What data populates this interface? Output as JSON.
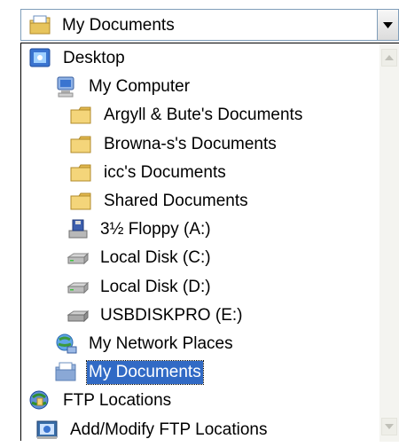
{
  "combo": {
    "selected_label": "My Documents",
    "selected_icon": "my-documents-icon"
  },
  "items": [
    {
      "label": "Desktop",
      "icon": "desktop-icon"
    },
    {
      "label": "My Computer",
      "icon": "my-computer-icon"
    },
    {
      "label": "Argyll & Bute's Documents",
      "icon": "folder-icon"
    },
    {
      "label": "Browna-s's Documents",
      "icon": "folder-icon"
    },
    {
      "label": "icc's Documents",
      "icon": "folder-icon"
    },
    {
      "label": "Shared Documents",
      "icon": "folder-icon"
    },
    {
      "label": "3½ Floppy (A:)",
      "icon": "floppy-drive-icon"
    },
    {
      "label": "Local Disk (C:)",
      "icon": "hard-disk-icon"
    },
    {
      "label": "Local Disk (D:)",
      "icon": "hard-disk-icon"
    },
    {
      "label": "USBDISKPRO (E:)",
      "icon": "usb-drive-icon"
    },
    {
      "label": "My Network Places",
      "icon": "network-places-icon"
    },
    {
      "label": "My Documents",
      "icon": "my-documents-icon",
      "selected": true
    },
    {
      "label": "FTP Locations",
      "icon": "ftp-locations-icon"
    },
    {
      "label": "Add/Modify FTP Locations",
      "icon": "add-ftp-location-icon"
    }
  ],
  "colors": {
    "selection": "#316ac5",
    "folder": "#f4d57a",
    "border": "#7f9db9"
  }
}
